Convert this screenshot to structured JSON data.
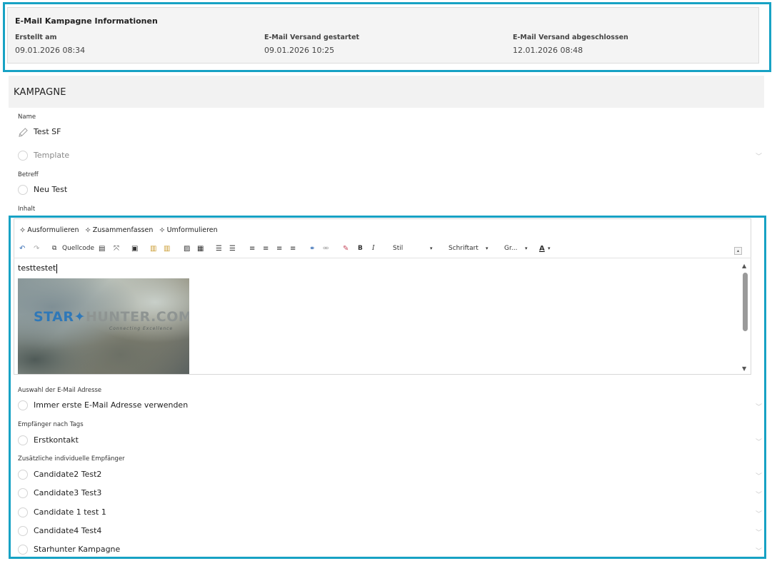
{
  "info": {
    "title": "E-Mail Kampagne Informationen",
    "created_label": "Erstellt am",
    "created_value": "09.01.2026 08:34",
    "started_label": "E-Mail Versand gestartet",
    "started_value": "09.01.2026 10:25",
    "finished_label": "E-Mail Versand abgeschlossen",
    "finished_value": "12.01.2026 08:48"
  },
  "section_title": "KAMPAGNE",
  "fields": {
    "name_label": "Name",
    "name_value": "Test SF",
    "template_placeholder": "Template",
    "subject_label": "Betreff",
    "subject_value": "Neu Test",
    "content_label": "Inhalt",
    "email_choice_label": "Auswahl der E-Mail Adresse",
    "email_choice_value": "Immer erste E-Mail Adresse verwenden",
    "tags_label": "Empfänger nach Tags",
    "tags_value": "Erstkontakt",
    "extra_label": "Zusätzliche individuelle Empfänger",
    "extra_recipients": [
      "Candidate2 Test2",
      "Candidate3 Test3",
      "Candidate 1 test 1",
      "Candidate4 Test4",
      "Starhunter Kampagne"
    ]
  },
  "editor": {
    "ai_buttons": [
      "Ausformulieren",
      "Zusammenfassen",
      "Umformulieren"
    ],
    "source_label": "Quellcode",
    "bold": "B",
    "italic": "I",
    "style_label": "Stil",
    "font_label": "Schriftart",
    "size_label": "Gr...",
    "font_color": "A",
    "content_text": "testtestet",
    "banner_star": "STAR",
    "banner_hunter": "HUNTER.COM",
    "banner_tagline": "Connecting Excellence"
  },
  "colors": {
    "highlight": "#17a2c4",
    "accent_blue": "#3a6fb5"
  },
  "icons": [
    "spark-icon",
    "undo-icon",
    "redo-icon",
    "source-icon",
    "maximize-icon",
    "image-icon",
    "table-icon",
    "list-icon",
    "link-icon",
    "eraser-icon",
    "chevron-down-icon",
    "pencil-icon",
    "radio-icon"
  ]
}
